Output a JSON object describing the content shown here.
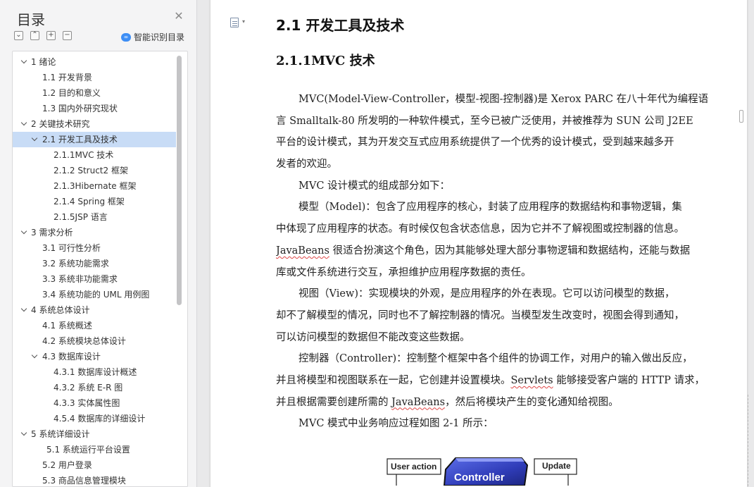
{
  "sidebar": {
    "title": "目录",
    "smart_toc_label": "智能识别目录",
    "tools": [
      "expand-all",
      "collapse-all",
      "add",
      "remove"
    ],
    "items": [
      {
        "label": "1  绪论",
        "level": 1,
        "chevron": true
      },
      {
        "label": "1.1 开发背景",
        "level": 2,
        "chevron": false
      },
      {
        "label": "1.2 目的和意义",
        "level": 2,
        "chevron": false
      },
      {
        "label": "1.3  国内外研究现状",
        "level": 2,
        "chevron": false
      },
      {
        "label": "2 关键技术研究",
        "level": 1,
        "chevron": true
      },
      {
        "label": "2.1 开发工具及技术",
        "level": 2,
        "chevron": true,
        "active": true
      },
      {
        "label": "2.1.1MVC 技术",
        "level": 3,
        "chevron": false
      },
      {
        "label": "2.1.2 Struct2 框架",
        "level": 3,
        "chevron": false
      },
      {
        "label": "2.1.3Hibernate 框架",
        "level": 3,
        "chevron": false
      },
      {
        "label": "2.1.4 Spring 框架",
        "level": 3,
        "chevron": false
      },
      {
        "label": "2.1.5JSP 语言",
        "level": 3,
        "chevron": false
      },
      {
        "label": "3  需求分析",
        "level": 1,
        "chevron": true
      },
      {
        "label": "3.1 可行性分析",
        "level": 2,
        "chevron": false
      },
      {
        "label": "3.2 系统功能需求",
        "level": 2,
        "chevron": false
      },
      {
        "label": "3.3 系统非功能需求",
        "level": 2,
        "chevron": false
      },
      {
        "label": "3.4  系统功能的 UML 用例图",
        "level": 2,
        "chevron": false
      },
      {
        "label": "4  系统总体设计",
        "level": 1,
        "chevron": true
      },
      {
        "label": "4.1  系统概述",
        "level": 2,
        "chevron": false
      },
      {
        "label": "4.2 系统模块总体设计",
        "level": 2,
        "chevron": false
      },
      {
        "label": "4.3 数据库设计",
        "level": 2,
        "chevron": true
      },
      {
        "label": "4.3.1 数据库设计概述",
        "level": 3,
        "chevron": false
      },
      {
        "label": "4.3.2 系统 E-R 图",
        "level": 3,
        "chevron": false
      },
      {
        "label": "4.3.3  实体属性图",
        "level": 3,
        "chevron": false
      },
      {
        "label": "4.5.4 数据库的详细设计",
        "level": 3,
        "chevron": false
      },
      {
        "label": "5  系统详细设计",
        "level": 1,
        "chevron": true
      },
      {
        "label": "5.1 系统运行平台设置",
        "level": 2,
        "chevron": false,
        "extra_indent": true
      },
      {
        "label": "5.2 用户登录",
        "level": 2,
        "chevron": false
      },
      {
        "label": "5.3 商品信息管理模块",
        "level": 2,
        "chevron": false
      }
    ]
  },
  "document": {
    "heading2": "2.1 开发工具及技术",
    "heading3": "2.1.1MVC 技术",
    "lines": [
      {
        "indent": true,
        "segments": [
          {
            "text": "MVC(Model-View-Controller，模型-视图-控制器)是 Xerox PARC 在八十年代为编程语"
          }
        ]
      },
      {
        "indent": false,
        "segments": [
          {
            "text": "言 Smalltalk-80 所发明的一种软件模式，至今已被广泛使用，并被推荐为 SUN 公司 J2EE"
          }
        ]
      },
      {
        "indent": false,
        "segments": [
          {
            "text": "平台的设计模式，其为开发交互式应用系统提供了一个优秀的设计模式，受到越来越多开"
          }
        ]
      },
      {
        "indent": false,
        "segments": [
          {
            "text": "发者的欢迎。"
          }
        ]
      },
      {
        "indent": true,
        "segments": [
          {
            "text": "MVC 设计模式的组成部分如下："
          }
        ]
      },
      {
        "indent": true,
        "segments": [
          {
            "text": "模型（Model)：包含了应用程序的核心，封装了应用程序的数据结构和事物逻辑，集"
          }
        ]
      },
      {
        "indent": false,
        "segments": [
          {
            "text": "中体现了应用程序的状态。有时候仅包含状态信息，因为它并不了解视图或控制器的信息。"
          }
        ]
      },
      {
        "indent": false,
        "segments": [
          {
            "text": "JavaBeans",
            "squiggle": true
          },
          {
            "text": " 很适合扮演这个角色，因为其能够处理大部分事物逻辑和数据结构，还能与数据"
          }
        ]
      },
      {
        "indent": false,
        "segments": [
          {
            "text": "库或文件系统进行交互，承担维护应用程序数据的责任。"
          }
        ]
      },
      {
        "indent": true,
        "segments": [
          {
            "text": "视图（View)：实现模块的外观，是应用程序的外在表现。它可以访问模型的数据，"
          }
        ]
      },
      {
        "indent": false,
        "segments": [
          {
            "text": "却不了解模型的情况，同时也不了解控制器的情况。当模型发生改变时，视图会得到通知，"
          }
        ]
      },
      {
        "indent": false,
        "segments": [
          {
            "text": "可以访问模型的数据但不能改变这些数据。"
          }
        ]
      },
      {
        "indent": true,
        "segments": [
          {
            "text": "控制器（Controller)：控制整个框架中各个组件的协调工作，对用户的输入做出反应，"
          }
        ]
      },
      {
        "indent": false,
        "segments": [
          {
            "text": "并且将模型和视图联系在一起，它创建并设置模块。"
          },
          {
            "text": "Servlets",
            "squiggle": true
          },
          {
            "text": " 能够接受客户端的 HTTP 请求，"
          }
        ]
      },
      {
        "indent": false,
        "segments": [
          {
            "text": "并且根据需要创建所需的 "
          },
          {
            "text": "JavaBeans",
            "squiggle": true
          },
          {
            "text": "，然后将模块产生的变化通知给视图。"
          }
        ]
      },
      {
        "indent": true,
        "segments": [
          {
            "text": "MVC 模式中业务响应过程如图 2-1 所示："
          }
        ]
      }
    ],
    "figure": {
      "user_action": "User action",
      "controller": "Controller",
      "update": "Update"
    }
  }
}
